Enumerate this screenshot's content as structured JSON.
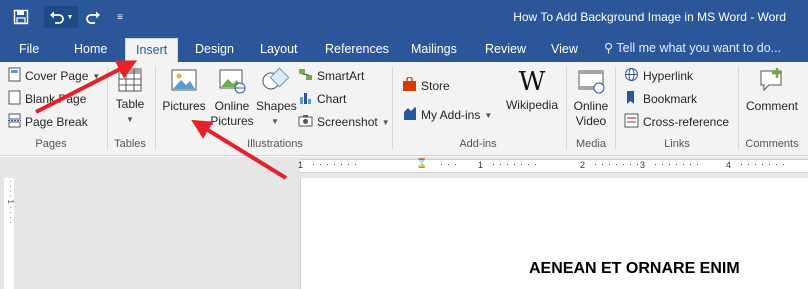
{
  "window": {
    "title": "How To Add Background Image in MS Word - Word"
  },
  "tabs": [
    {
      "label": "File"
    },
    {
      "label": "Home"
    },
    {
      "label": "Insert"
    },
    {
      "label": "Design"
    },
    {
      "label": "Layout"
    },
    {
      "label": "References"
    },
    {
      "label": "Mailings"
    },
    {
      "label": "Review"
    },
    {
      "label": "View"
    }
  ],
  "tell_me": {
    "placeholder": "Tell me what you want to do..."
  },
  "groups": {
    "pages": {
      "label": "Pages",
      "cover_page": "Cover Page",
      "blank_page": "Blank Page",
      "page_break": "Page Break"
    },
    "tables": {
      "label": "Tables",
      "table": "Table"
    },
    "illustrations": {
      "label": "Illustrations",
      "pictures": "Pictures",
      "online_pictures_1": "Online",
      "online_pictures_2": "Pictures",
      "shapes": "Shapes",
      "smartart": "SmartArt",
      "chart": "Chart",
      "screenshot": "Screenshot"
    },
    "addins": {
      "label": "Add-ins",
      "store": "Store",
      "my_addins": "My Add-ins",
      "wikipedia": "Wikipedia"
    },
    "media": {
      "label": "Media",
      "online_video_1": "Online",
      "online_video_2": "Video"
    },
    "links": {
      "label": "Links",
      "hyperlink": "Hyperlink",
      "bookmark": "Bookmark",
      "cross_reference": "Cross-reference"
    },
    "comments": {
      "label": "Comments",
      "comment": "Comment"
    }
  },
  "ruler": {
    "marks": [
      "1",
      "2",
      "3",
      "4"
    ]
  },
  "document": {
    "heading": "AENEAN ET ORNARE ENIM"
  },
  "colors": {
    "title_bar": "#2b579a",
    "annotation_arrow": "#e8202a",
    "ribbon": "#f3f3f3"
  },
  "icons": [
    "save-icon",
    "undo-icon",
    "redo-icon",
    "customize-qat-icon",
    "lightbulb-icon"
  ]
}
